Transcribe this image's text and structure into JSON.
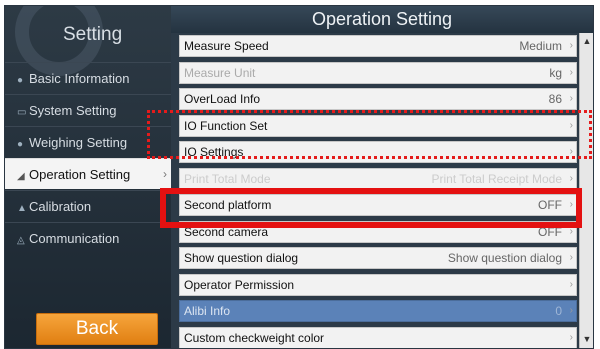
{
  "sidebar": {
    "title": "Setting",
    "items": [
      {
        "icon": "circle-info-icon",
        "glyph": "●",
        "label": "Basic Information"
      },
      {
        "icon": "system-icon",
        "glyph": "▭",
        "label": "System Setting"
      },
      {
        "icon": "weighing-icon",
        "glyph": "●",
        "label": "Weighing Setting"
      },
      {
        "icon": "operation-icon",
        "glyph": "◢",
        "label": "Operation Setting"
      },
      {
        "icon": "calibration-icon",
        "glyph": "▲",
        "label": "Calibration"
      },
      {
        "icon": "communication-icon",
        "glyph": "◬",
        "label": "Communication"
      }
    ],
    "active_index": 3,
    "active_arrow": "›",
    "back_label": "Back"
  },
  "main": {
    "title": "Operation Setting",
    "rows": [
      {
        "label": "Measure Speed",
        "value": "Medium",
        "state": "normal"
      },
      {
        "label": "Measure Unit",
        "value": "kg",
        "state": "disabled"
      },
      {
        "label": "OverLoad Info",
        "value": "86",
        "state": "normal"
      },
      {
        "label": "IO Function Set",
        "value": "",
        "state": "normal"
      },
      {
        "label": "IO Settings",
        "value": "",
        "state": "normal"
      },
      {
        "label": "Print Total Mode",
        "value": "Print Total Receipt Mode",
        "state": "faded"
      },
      {
        "label": "Second platform",
        "value": "OFF",
        "state": "normal"
      },
      {
        "label": "Second camera",
        "value": "OFF",
        "state": "normal"
      },
      {
        "label": "Show question dialog",
        "value": "Show question dialog",
        "state": "normal"
      },
      {
        "label": "Operator Permission",
        "value": "",
        "state": "normal"
      },
      {
        "label": "Alibi Info",
        "value": "0",
        "state": "highlight"
      },
      {
        "label": "Custom checkweight color",
        "value": "",
        "state": "normal"
      }
    ],
    "row_arrow": "›"
  },
  "scrollbar": {
    "up": "▲",
    "down": "▼"
  },
  "annotation_colors": {
    "red": "#e41111"
  }
}
